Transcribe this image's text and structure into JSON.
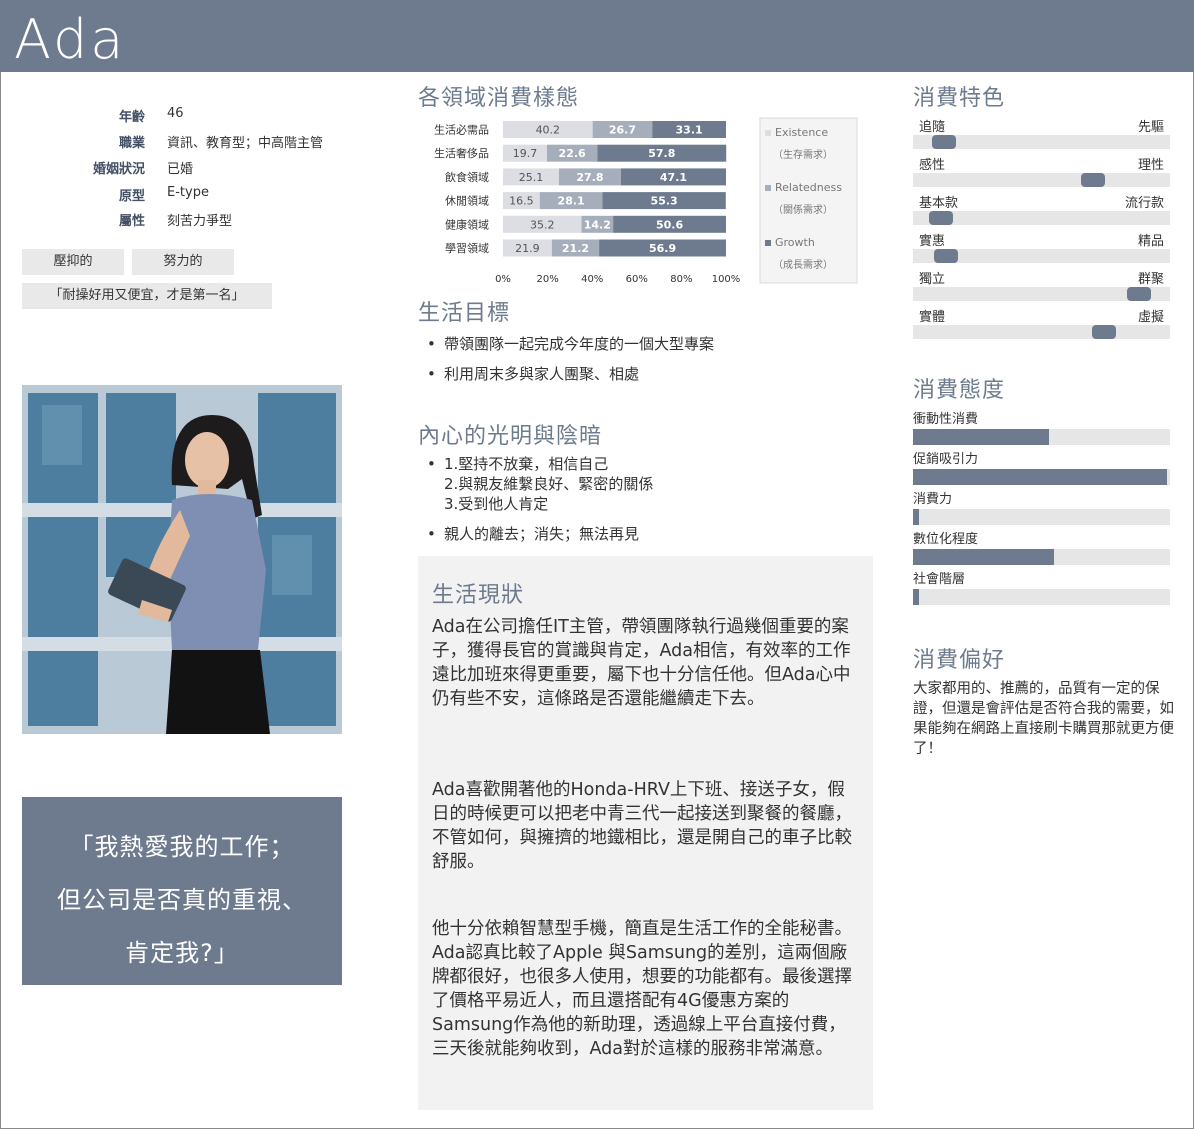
{
  "persona": {
    "name": "Ada",
    "info": [
      {
        "label": "年齡",
        "value": "46"
      },
      {
        "label": "職業",
        "value": "資訊、教育型；中高階主管"
      },
      {
        "label": "婚姻狀況",
        "value": "已婚"
      },
      {
        "label": "原型",
        "value": "E-type"
      },
      {
        "label": "屬性",
        "value": "刻苦力爭型"
      }
    ],
    "tags": [
      "壓抑的",
      "努力的",
      "「耐操好用又便宜，才是第一名」"
    ],
    "quote_lines": [
      "「我熱愛我的工作；",
      "但公司是否真的重視、",
      "肯定我?」"
    ]
  },
  "sections": {
    "consumption_pattern": "各領域消費樣態",
    "life_goals": "生活目標",
    "light_dark": "內心的光明與陰暗",
    "life_status": "生活現狀",
    "traits": "消費特色",
    "attitude": "消費態度",
    "preference": "消費偏好"
  },
  "chart_data": {
    "type": "bar",
    "orientation": "horizontal",
    "stacked": true,
    "categories": [
      "生活必需品",
      "生活奢侈品",
      "飲食領域",
      "休閒領域",
      "健康領域",
      "學習領域"
    ],
    "series": [
      {
        "name": "Existence",
        "subname": "（生存需求）",
        "color": "#dcdee3",
        "values": [
          40.2,
          19.7,
          25.1,
          16.5,
          35.2,
          21.9
        ]
      },
      {
        "name": "Relatedness",
        "subname": "（關係需求）",
        "color": "#a7aebb",
        "values": [
          26.7,
          22.6,
          27.8,
          28.1,
          14.2,
          21.2
        ]
      },
      {
        "name": "Growth",
        "subname": "（成長需求）",
        "color": "#6e7b8e",
        "values": [
          33.1,
          57.8,
          47.1,
          55.3,
          50.6,
          56.9
        ]
      }
    ],
    "xticks": [
      "0%",
      "20%",
      "40%",
      "60%",
      "80%",
      "100%"
    ],
    "xlim": [
      0,
      100
    ],
    "legend": "right"
  },
  "life_goals": [
    "帶領團隊一起完成今年度的一個大型專案",
    "利用周末多與家人團聚、相處"
  ],
  "light_dark": {
    "light": [
      "1.堅持不放棄，相信自己",
      "2.與親友維繫良好、緊密的關係",
      "3.受到他人肯定"
    ],
    "dark": "親人的離去；消失；無法再見"
  },
  "life_status": [
    "Ada在公司擔任IT主管，帶領團隊執行過幾個重要的案子，獲得長官的賞識與肯定，Ada相信，有效率的工作遠比加班來得更重要，屬下也十分信任他。但Ada心中仍有些不安，這條路是否還能繼續走下去。",
    "Ada喜歡開著他的Honda-HRV上下班、接送子女，假日的時候更可以把老中青三代一起接送到聚餐的餐廳，不管如何，與擁擠的地鐵相比，還是開自己的車子比較舒服。",
    "他十分依賴智慧型手機，簡直是生活工作的全能秘書。Ada認真比較了Apple 與Samsung的差別，這兩個廠牌都很好，也很多人使用，想要的功能都有。最後選擇了價格平易近人，而且還搭配有4G優惠方案的Samsung作為他的新助理，透過線上平台直接付費，三天後就能夠收到，Ada對於這樣的服務非常滿意。"
  ],
  "traits": [
    {
      "left": "追隨",
      "right": "先驅",
      "level": 0.08
    },
    {
      "left": "感性",
      "right": "理性",
      "level": 0.72
    },
    {
      "left": "基本款",
      "right": "流行款",
      "level": 0.07
    },
    {
      "left": "實惠",
      "right": "精品",
      "level": 0.09
    },
    {
      "left": "獨立",
      "right": "群聚",
      "level": 0.92
    },
    {
      "left": "實體",
      "right": "虛擬",
      "level": 0.77
    }
  ],
  "attitude": [
    {
      "label": "衝動性消費",
      "level": 0.53
    },
    {
      "label": "促銷吸引力",
      "level": 0.99
    },
    {
      "label": "消費力",
      "level": 0.02
    },
    {
      "label": "數位化程度",
      "level": 0.55
    },
    {
      "label": "社會階層",
      "level": 0.02
    }
  ],
  "preference_text": "大家都用的、推薦的，品質有一定的保證，但還是會評估是否符合我的需要，如果能夠在網路上直接刷卡購買那就更方便了！",
  "colors": {
    "accent": "#6e7b8e",
    "panel": "#f2f2f2",
    "track": "#e6e6e6"
  }
}
